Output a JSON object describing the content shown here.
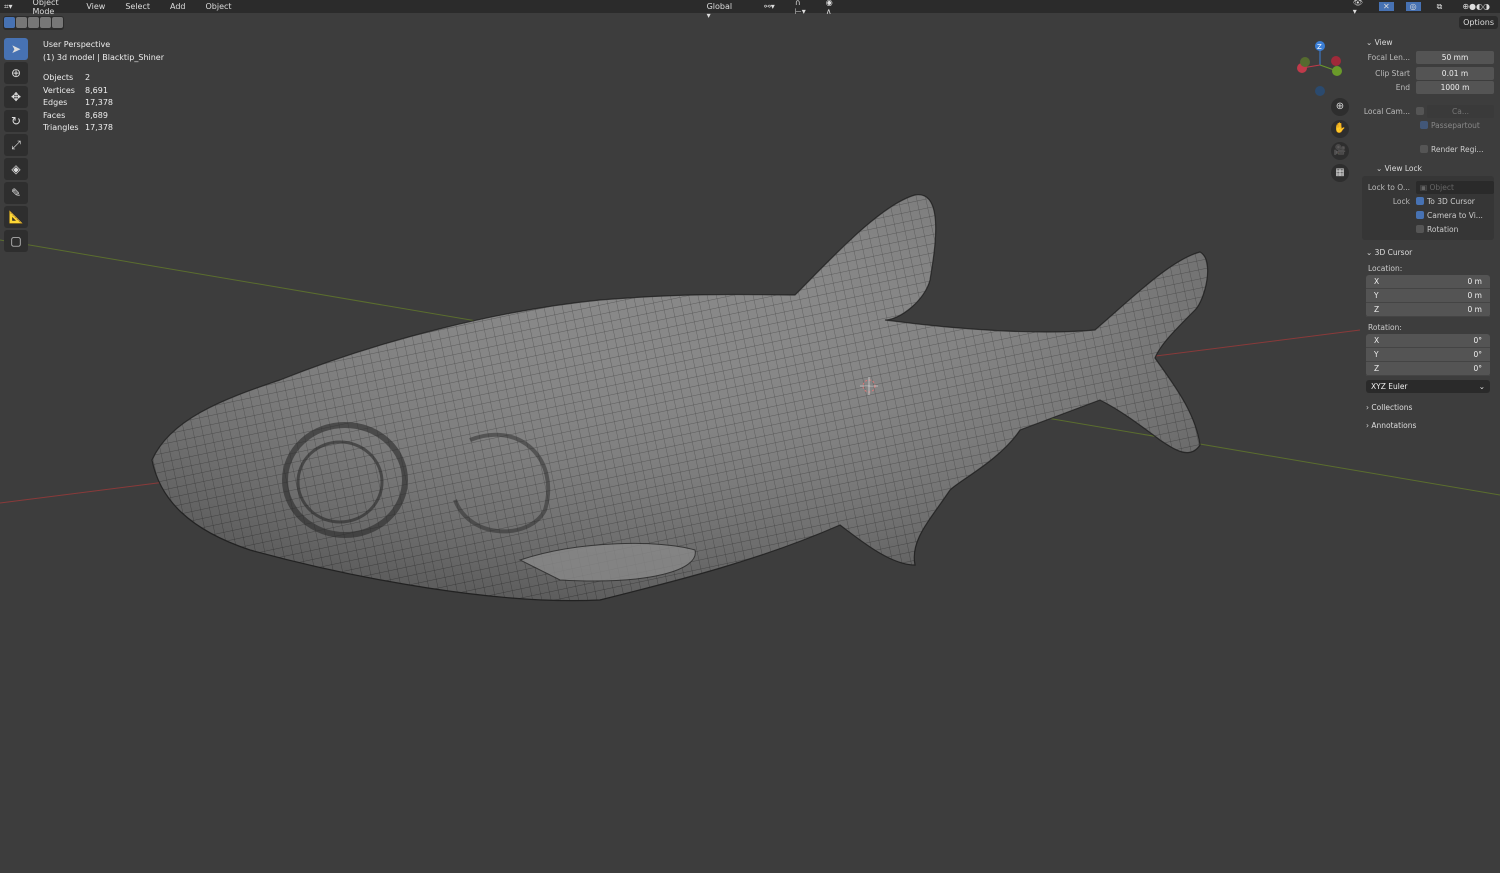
{
  "header": {
    "mode": "Object Mode",
    "menus": [
      "View",
      "Select",
      "Add",
      "Object"
    ],
    "transform_orientation": "Global",
    "options_label": "Options"
  },
  "overlay": {
    "view_name": "User Perspective",
    "object": "(1) 3d model | Blacktip_Shiner",
    "stats": [
      {
        "label": "Objects",
        "value": "2"
      },
      {
        "label": "Vertices",
        "value": "8,691"
      },
      {
        "label": "Edges",
        "value": "17,378"
      },
      {
        "label": "Faces",
        "value": "8,689"
      },
      {
        "label": "Triangles",
        "value": "17,378"
      }
    ]
  },
  "gizmo": {
    "z": "Z"
  },
  "panel": {
    "view": {
      "title": "View",
      "focal_label": "Focal Len...",
      "focal": "50 mm",
      "clip_start_label": "Clip Start",
      "clip_start": "0.01 m",
      "end_label": "End",
      "end": "1000 m",
      "local_cam_label": "Local Cam...",
      "local_cam": "Ca...",
      "passepartout": "Passepartout",
      "render_region": "Render Regi..."
    },
    "view_lock": {
      "title": "View Lock",
      "lock_to_label": "Lock to O...",
      "lock_to_placeholder": "Object",
      "lock_label": "Lock",
      "to_cursor": "To 3D Cursor",
      "camera_to_view": "Camera to Vi...",
      "rotation": "Rotation"
    },
    "cursor": {
      "title": "3D Cursor",
      "location_label": "Location:",
      "loc": [
        {
          "axis": "X",
          "value": "0 m"
        },
        {
          "axis": "Y",
          "value": "0 m"
        },
        {
          "axis": "Z",
          "value": "0 m"
        }
      ],
      "rotation_label": "Rotation:",
      "rot": [
        {
          "axis": "X",
          "value": "0°"
        },
        {
          "axis": "Y",
          "value": "0°"
        },
        {
          "axis": "Z",
          "value": "0°"
        }
      ],
      "mode": "XYZ Euler"
    },
    "collections": "Collections",
    "annotations": "Annotations"
  }
}
